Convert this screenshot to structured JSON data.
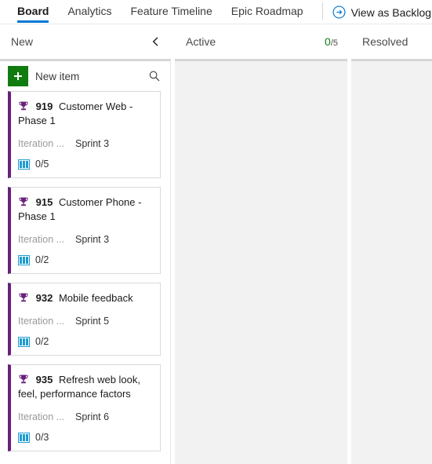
{
  "tabs": [
    {
      "label": "Board",
      "active": true
    },
    {
      "label": "Analytics",
      "active": false
    },
    {
      "label": "Feature Timeline",
      "active": false
    },
    {
      "label": "Epic Roadmap",
      "active": false
    }
  ],
  "backlog_link": {
    "label": "View as Backlog",
    "icon": "circle-arrow-right-icon"
  },
  "columns": [
    {
      "title": "New",
      "wip_current": "",
      "wip_limit": "",
      "collapse_icon": "chevron-left-icon"
    },
    {
      "title": "Active",
      "wip_current": "0",
      "wip_limit": "/5",
      "collapse_icon": ""
    },
    {
      "title": "Resolved",
      "wip_current": "",
      "wip_limit": "",
      "collapse_icon": ""
    }
  ],
  "toolbar": {
    "new_item_label": "New item",
    "plus_icon": "plus-icon",
    "search_icon": "search-icon"
  },
  "cards": [
    {
      "id": "919",
      "title": "Customer Web - Phase 1",
      "field_label": "Iteration ...",
      "field_value": "Sprint 3",
      "children": "0/5",
      "type_icon": "trophy-icon"
    },
    {
      "id": "915",
      "title": "Customer Phone - Phase 1",
      "field_label": "Iteration ...",
      "field_value": "Sprint 3",
      "children": "0/2",
      "type_icon": "trophy-icon"
    },
    {
      "id": "932",
      "title": "Mobile feedback",
      "field_label": "Iteration ...",
      "field_value": "Sprint 5",
      "children": "0/2",
      "type_icon": "trophy-icon"
    },
    {
      "id": "935",
      "title": "Refresh web look, feel, performance factors",
      "field_label": "Iteration ...",
      "field_value": "Sprint 6",
      "children": "0/3",
      "type_icon": "trophy-icon"
    }
  ],
  "colors": {
    "accent": "#0078d4",
    "epic_purple": "#68217a",
    "new_item_green": "#107c10",
    "wip_green": "#107c10",
    "child_blue": "#1f9bcf",
    "column_bg": "#f2f2f2"
  }
}
